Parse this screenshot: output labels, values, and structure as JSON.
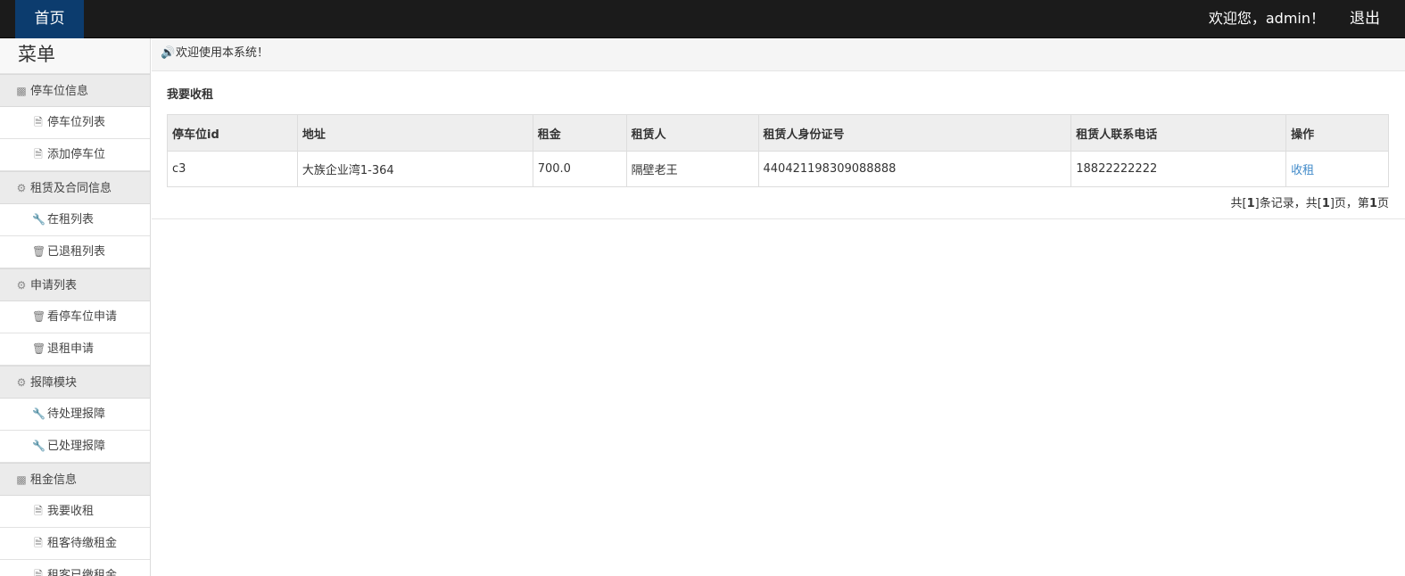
{
  "topbar": {
    "home_label": "首页",
    "welcome_text": "欢迎您，admin！",
    "logout_label": "退出"
  },
  "sidebar": {
    "title": "菜单",
    "groups": [
      {
        "label": "停车位信息",
        "icon": "user-card-icon",
        "items": [
          {
            "label": "停车位列表",
            "icon": "file-icon"
          },
          {
            "label": "添加停车位",
            "icon": "file-icon"
          }
        ]
      },
      {
        "label": "租赁及合同信息",
        "icon": "gear-icon",
        "items": [
          {
            "label": "在租列表",
            "icon": "wrench-icon"
          },
          {
            "label": "已退租列表",
            "icon": "trash-icon"
          }
        ]
      },
      {
        "label": "申请列表",
        "icon": "gear-icon",
        "items": [
          {
            "label": "看停车位申请",
            "icon": "trash-icon"
          },
          {
            "label": "退租申请",
            "icon": "trash-icon"
          }
        ]
      },
      {
        "label": "报障模块",
        "icon": "gear-icon",
        "items": [
          {
            "label": "待处理报障",
            "icon": "wrench-icon"
          },
          {
            "label": "已处理报障",
            "icon": "wrench-icon"
          }
        ]
      },
      {
        "label": "租金信息",
        "icon": "user-card-icon",
        "items": [
          {
            "label": "我要收租",
            "icon": "file-icon"
          },
          {
            "label": "租客待缴租金",
            "icon": "file-icon"
          },
          {
            "label": "租客已缴租金",
            "icon": "file-icon"
          }
        ]
      }
    ]
  },
  "notice": {
    "icon": "speaker-icon",
    "text": "欢迎使用本系统！"
  },
  "section": {
    "title": "我要收租"
  },
  "table": {
    "columns": [
      "停车位id",
      "地址",
      "租金",
      "租赁人",
      "租赁人身份证号",
      "租赁人联系电话",
      "操作"
    ],
    "rows": [
      {
        "id": "c3",
        "address": "大族企业湾1-364",
        "rent": "700.0",
        "tenant": "隔壁老王",
        "id_number": "440421198309088888",
        "phone": "18822222222",
        "action": "收租"
      }
    ]
  },
  "pagination": {
    "prefix": "共[",
    "total_records": "1",
    "mid1": "]条记录，共[",
    "total_pages": "1",
    "mid2": "]页，第",
    "current_page": "1",
    "suffix": "页"
  },
  "colors": {
    "topbar_bg": "#1b1b1b",
    "home_tab_bg": "#0c3c6e",
    "link": "#428bca"
  }
}
